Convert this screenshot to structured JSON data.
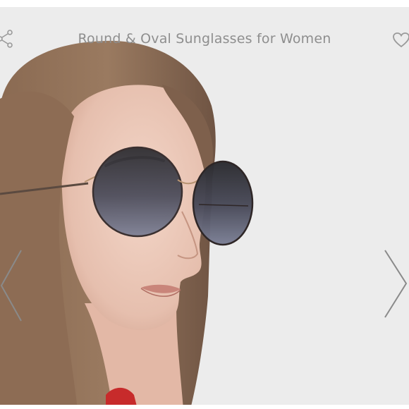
{
  "product": {
    "title": "Round & Oval Sunglasses for Women"
  },
  "icons": {
    "share": "share-icon",
    "favorite": "heart-icon",
    "previous": "chevron-left-icon",
    "next": "chevron-right-icon"
  },
  "colors": {
    "background": "#ececec",
    "title_text": "#8e8e8e",
    "icon_stroke": "#9a9a9a"
  }
}
